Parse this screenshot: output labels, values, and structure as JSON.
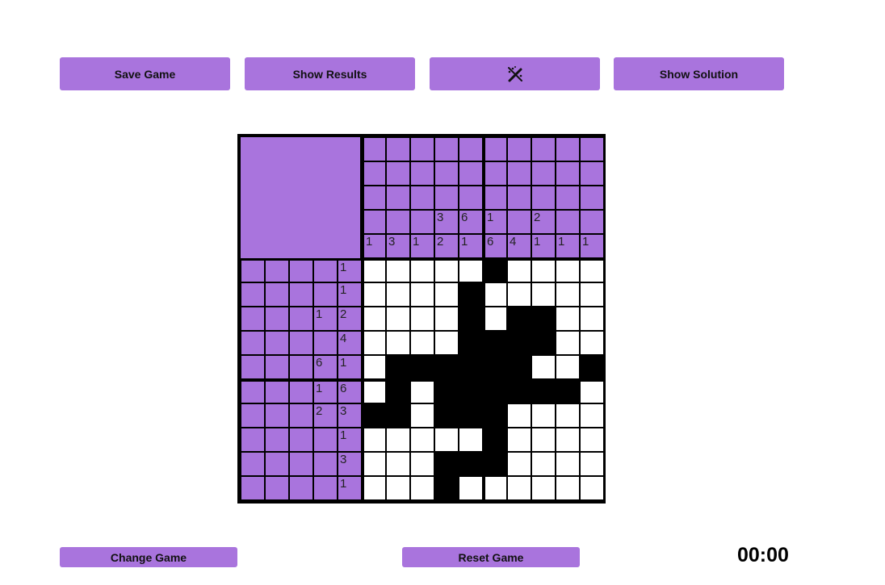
{
  "buttons": {
    "save": "Save Game",
    "results": "Show Results",
    "hint_icon": "magic-wand-off-icon",
    "solution": "Show Solution",
    "change": "Change Game",
    "reset": "Reset Game"
  },
  "timer": "00:00",
  "colors": {
    "accent": "#a974dd",
    "filled": "#000000",
    "empty": "#ffffff"
  },
  "puzzle": {
    "size": 10,
    "column_clues": [
      [
        "1"
      ],
      [
        "3"
      ],
      [
        "1"
      ],
      [
        "3",
        "2"
      ],
      [
        "6",
        "1"
      ],
      [
        "1",
        "6"
      ],
      [
        "4"
      ],
      [
        "2",
        "1"
      ],
      [
        "1"
      ],
      [
        "1"
      ]
    ],
    "row_clues": [
      [
        "1"
      ],
      [
        "1"
      ],
      [
        "1",
        "2"
      ],
      [
        "4"
      ],
      [
        "6",
        "1"
      ],
      [
        "1",
        "6"
      ],
      [
        "2",
        "3"
      ],
      [
        "1"
      ],
      [
        "3"
      ],
      [
        "1"
      ]
    ],
    "grid": [
      "0000010000",
      "0000100000",
      "0000101100",
      "0000111100",
      "0111111001",
      "0101111110",
      "1101110000",
      "0000010000",
      "0001110000",
      "0001000000"
    ]
  }
}
